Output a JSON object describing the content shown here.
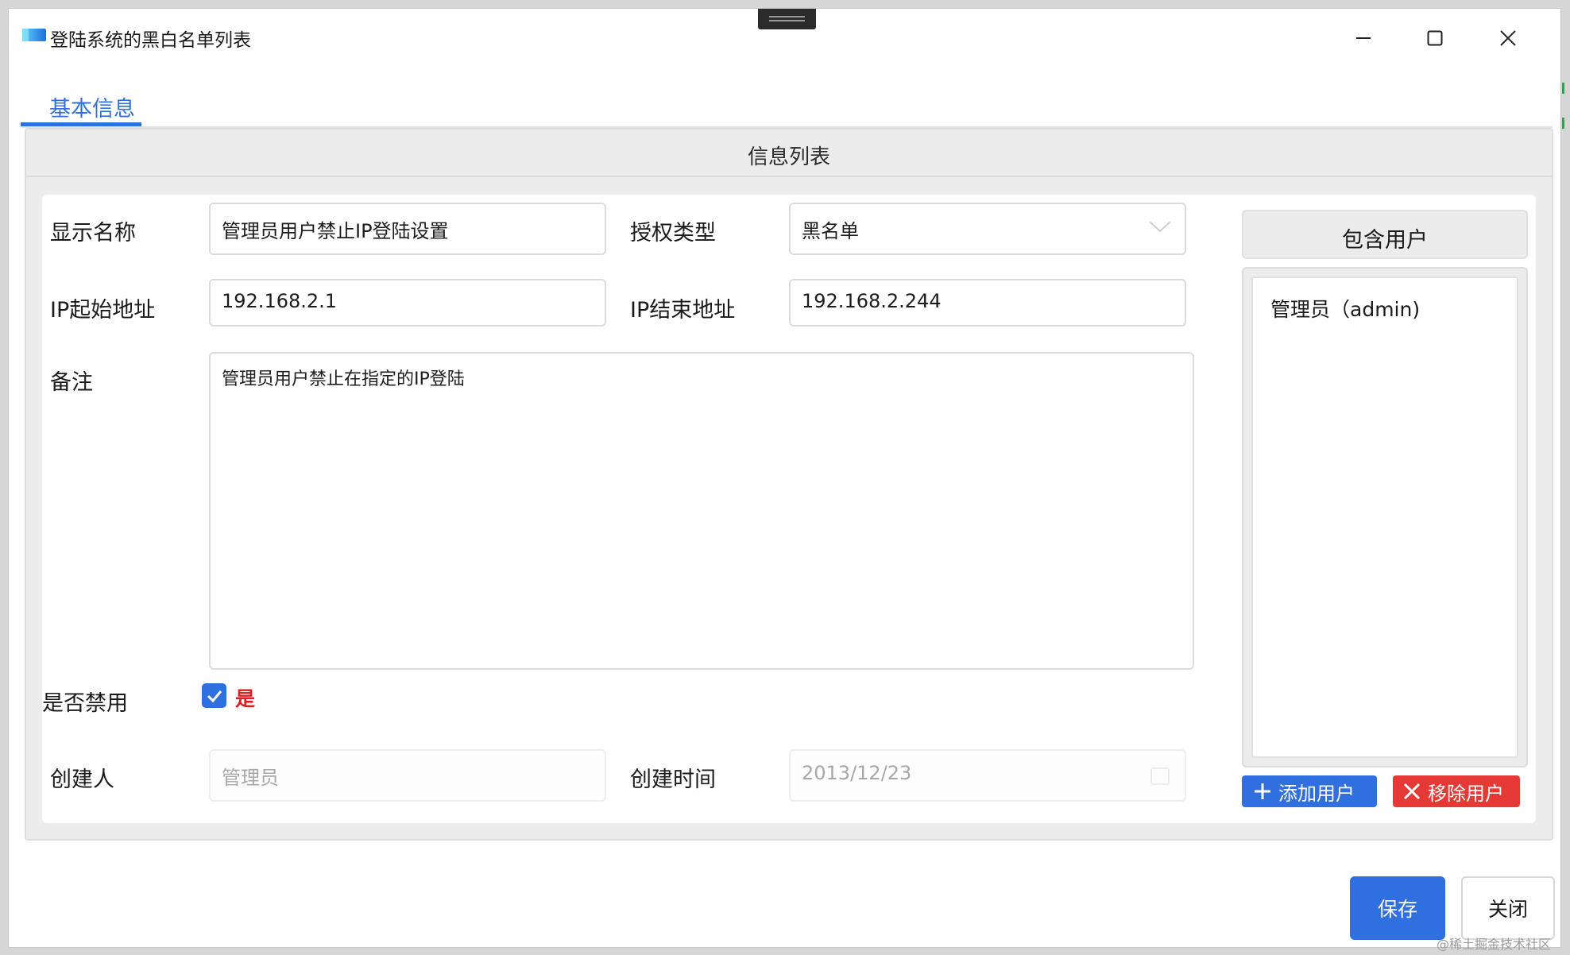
{
  "window": {
    "title": "登陆系统的黑白名单列表",
    "controls": {
      "minimize": "minimize-icon",
      "maximize": "maximize-icon",
      "close": "close-icon"
    }
  },
  "tabs": [
    {
      "label": "基本信息",
      "active": true
    }
  ],
  "panel": {
    "title": "信息列表"
  },
  "form": {
    "display_name": {
      "label": "显示名称",
      "value": "管理员用户禁止IP登陆设置"
    },
    "auth_type": {
      "label": "授权类型",
      "value": "黑名单"
    },
    "ip_start": {
      "label": "IP起始地址",
      "value": "192.168.2.1"
    },
    "ip_end": {
      "label": "IP结束地址",
      "value": "192.168.2.244"
    },
    "remark": {
      "label": "备注",
      "value": "管理员用户禁止在指定的IP登陆"
    },
    "disabled": {
      "label": "是否禁用",
      "checked": true,
      "checkbox_text": "是"
    },
    "creator": {
      "label": "创建人",
      "value": "管理员"
    },
    "created_time": {
      "label": "创建时间",
      "value": "2013/12/23"
    }
  },
  "users": {
    "header": "包含用户",
    "items": [
      "管理员（admin)"
    ],
    "add_button": "添加用户",
    "remove_button": "移除用户"
  },
  "footer": {
    "save": "保存",
    "close": "关闭"
  },
  "watermark": "@稀土掘金技术社区",
  "colors": {
    "accent": "#2f6fe0",
    "danger": "#e53935",
    "checkbox_text": "#e02020"
  }
}
